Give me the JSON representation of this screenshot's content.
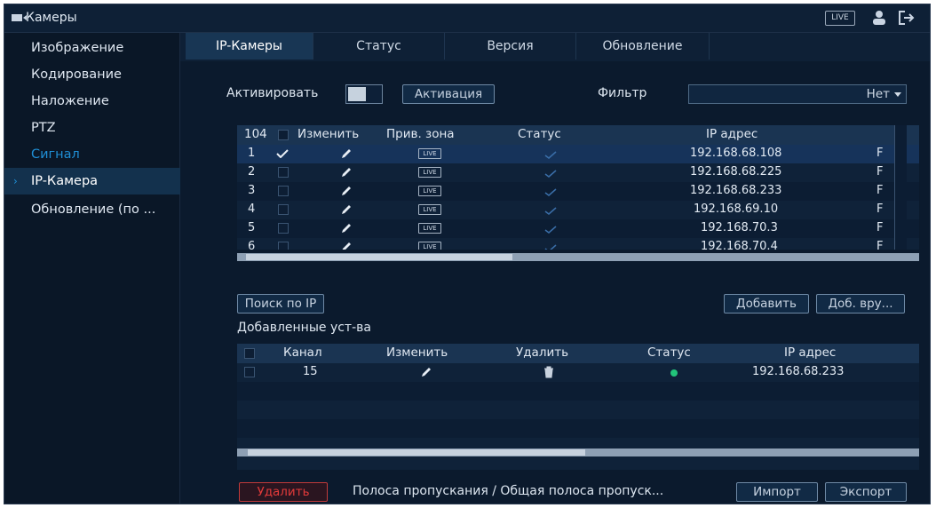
{
  "topbar": {
    "title": "Камеры",
    "live_label": "LIVE"
  },
  "sidebar": {
    "items": [
      {
        "label": "Изображение"
      },
      {
        "label": "Кодирование"
      },
      {
        "label": "Наложение"
      },
      {
        "label": "PTZ"
      },
      {
        "label": "Сигнал"
      },
      {
        "label": "IP-Камера"
      },
      {
        "label": "Обновление (по ..."
      }
    ]
  },
  "tabs": [
    {
      "label": "IP-Камеры"
    },
    {
      "label": "Статус"
    },
    {
      "label": "Версия"
    },
    {
      "label": "Обновление"
    }
  ],
  "activate": {
    "label": "Активировать",
    "button": "Активация"
  },
  "filter": {
    "label": "Фильтр",
    "value": "Нет"
  },
  "device_table": {
    "count": "104",
    "headers": {
      "edit": "Изменить",
      "zone": "Прив. зона",
      "status": "Статус",
      "ip": "IP адрес"
    },
    "rows": [
      {
        "num": "1",
        "ip": "192.168.68.108",
        "checked": true
      },
      {
        "num": "2",
        "ip": "192.168.68.225",
        "checked": false
      },
      {
        "num": "3",
        "ip": "192.168.68.233",
        "checked": false
      },
      {
        "num": "4",
        "ip": "192.168.69.10",
        "checked": false
      },
      {
        "num": "5",
        "ip": "192.168.70.3",
        "checked": false
      },
      {
        "num": "6",
        "ip": "192.168.70.4",
        "checked": false
      }
    ],
    "live_tag": "LIVE",
    "trunc_char": "F"
  },
  "actions": {
    "search_ip": "Поиск по IP",
    "add": "Добавить",
    "manual_add": "Доб. вру..."
  },
  "added": {
    "title": "Добавленные уст-ва",
    "headers": {
      "channel": "Канал",
      "edit": "Изменить",
      "delete": "Удалить",
      "status": "Статус",
      "ip": "IP адрес"
    },
    "rows": [
      {
        "channel": "15",
        "ip": "192.168.68.233"
      }
    ]
  },
  "bottom": {
    "delete": "Удалить",
    "bandwidth": "Полоса пропускания / Общая полоса пропуск...",
    "import": "Импорт",
    "export": "Экспорт"
  },
  "colors": {
    "accent": "#1f8fd6",
    "status_ok": "#22c47a",
    "danger": "#e23a3a"
  }
}
